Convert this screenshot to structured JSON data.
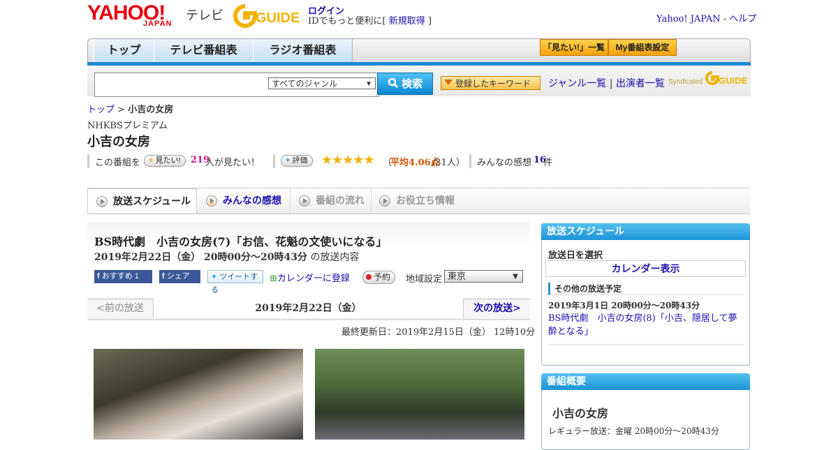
{
  "header": {
    "logo_yahoo": "YAHOO!",
    "logo_japan": "JAPAN",
    "logo_tv": "テレビ",
    "logo_gguide": "GUIDE",
    "login_label": "ログイン",
    "login_sub_prefix": "IDでもっと便利に[",
    "register_label": "新規取得",
    "login_sub_suffix": "]",
    "yahoo_japan_link": "Yahoo! JAPAN",
    "separator": "-",
    "help_link": "ヘルプ"
  },
  "nav": {
    "tabs": [
      "トップ",
      "テレビ番組表",
      "ラジオ番組表"
    ],
    "want_list_label": "「見たい!」一覧",
    "my_listings_label": "My番組表設定"
  },
  "search": {
    "input_value": "",
    "genre_selected": "すべてのジャンル",
    "search_button": "検索",
    "keyword_button": "登録したキーワード",
    "genre_list_link": "ジャンル一覧",
    "divider": "|",
    "performer_list_link": "出演者一覧",
    "syndicated": "Syndicated"
  },
  "breadcrumb": {
    "top": "トップ",
    "sep": ">",
    "current": "小吉の女房"
  },
  "program": {
    "channel": "NHKBSプレミアム",
    "title": "小吉の女房",
    "want_prefix": "この番組を",
    "want_button": "見たい!",
    "want_count": "219",
    "want_suffix": "人が見たい！",
    "rating_button": "評価",
    "stars": "★★★★★",
    "rating_open": "（",
    "rating_avg": "平均4.06点",
    "rating_count": "/31人）",
    "impressions_prefix": "みんなの感想",
    "impressions_count": "16",
    "impressions_suffix": "件"
  },
  "subtabs": [
    "放送スケジュール",
    "みんなの感想",
    "番組の流れ",
    "お役立ち情報"
  ],
  "episode": {
    "title": "BS時代劇　小吉の女房(7)「お信、花魁の文使いになる」",
    "date_time": "2019年2月22日（金） 20時00分～20時43分",
    "date_suffix": "の放送内容",
    "recommend": "おすすめ 1",
    "share": "シェア",
    "tweet": "ツイートする",
    "calendar_add": "カレンダーに登録",
    "reserve": "予約",
    "region_label": "地域設定",
    "region_value": "東京"
  },
  "pager": {
    "prev": "<前の放送",
    "current": "2019年2月22日（金）",
    "next": "次の放送>"
  },
  "updated": "最終更新日：2019年2月15日（金） 12時10分",
  "sidebar": {
    "schedule_head": "放送スケジュール",
    "select_date": "放送日を選択",
    "calendar_button": "カレンダー表示",
    "other_head": "その他の放送予定",
    "other_date": "2019年3月1日 20時00分～20時43分",
    "other_link": "BS時代劇　小吉の女房(8)「小吉、隠居して夢酔となる」",
    "overview_head": "番組概要",
    "overview_title": "小吉の女房",
    "regular": "レギュラー放送：金曜 20時00分～20時43分"
  },
  "colors": {
    "accent": "#1c8ad4",
    "brand_red": "#e60012",
    "link": "#1a0dab",
    "orange": "#f3a10f"
  }
}
